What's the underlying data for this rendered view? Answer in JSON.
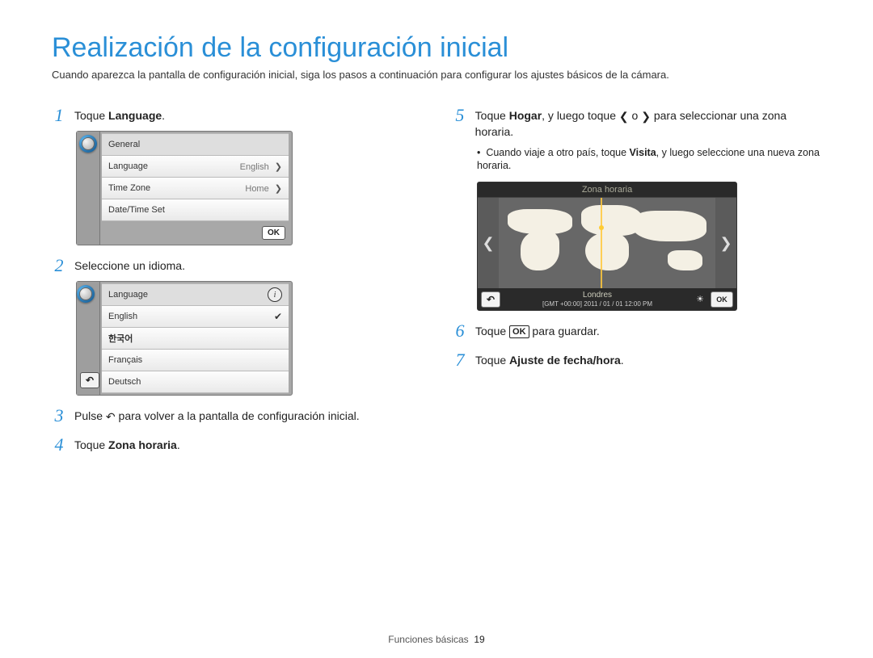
{
  "header": {
    "title": "Realización de la configuración inicial",
    "intro": "Cuando aparezca la pantalla de configuración inicial, siga los pasos a continuación para configurar los ajustes básicos de la cámara."
  },
  "steps": {
    "s1_a": "Toque ",
    "s1_b": "Language",
    "s1_c": ".",
    "s2": "Seleccione un idioma.",
    "s3_a": "Pulse ",
    "s3_b": " para volver a la pantalla de configuración inicial.",
    "s4_a": "Toque ",
    "s4_b": "Zona horaria",
    "s4_c": ".",
    "s5_a": "Toque ",
    "s5_b": "Hogar",
    "s5_c": ", y luego toque ",
    "s5_d": " o ",
    "s5_e": " para seleccionar una zona horaria.",
    "s5_bullet_a": "Cuando viaje a otro país, toque ",
    "s5_bullet_b": "Visita",
    "s5_bullet_c": ", y luego seleccione una nueva zona horaria.",
    "s6_a": "Toque ",
    "s6_b": " para guardar.",
    "s7_a": "Toque ",
    "s7_b": "Ajuste de fecha/hora",
    "s7_c": "."
  },
  "ok_label": "OK",
  "ui1": {
    "header": "General",
    "rows": [
      {
        "label": "Language",
        "value": "English"
      },
      {
        "label": "Time Zone",
        "value": "Home"
      },
      {
        "label": "Date/Time Set",
        "value": ""
      }
    ],
    "ok": "OK"
  },
  "ui2": {
    "header": "Language",
    "options": [
      "English",
      "한국어",
      "Français",
      "Deutsch"
    ],
    "selected_index": 0
  },
  "tz": {
    "title": "Zona horaria",
    "city": "Londres",
    "gmt": "[GMT +00:00]",
    "datetime": "2011 / 01 / 01  12:00 PM",
    "ok": "OK"
  },
  "footer": {
    "section": "Funciones básicas",
    "page": "19"
  }
}
